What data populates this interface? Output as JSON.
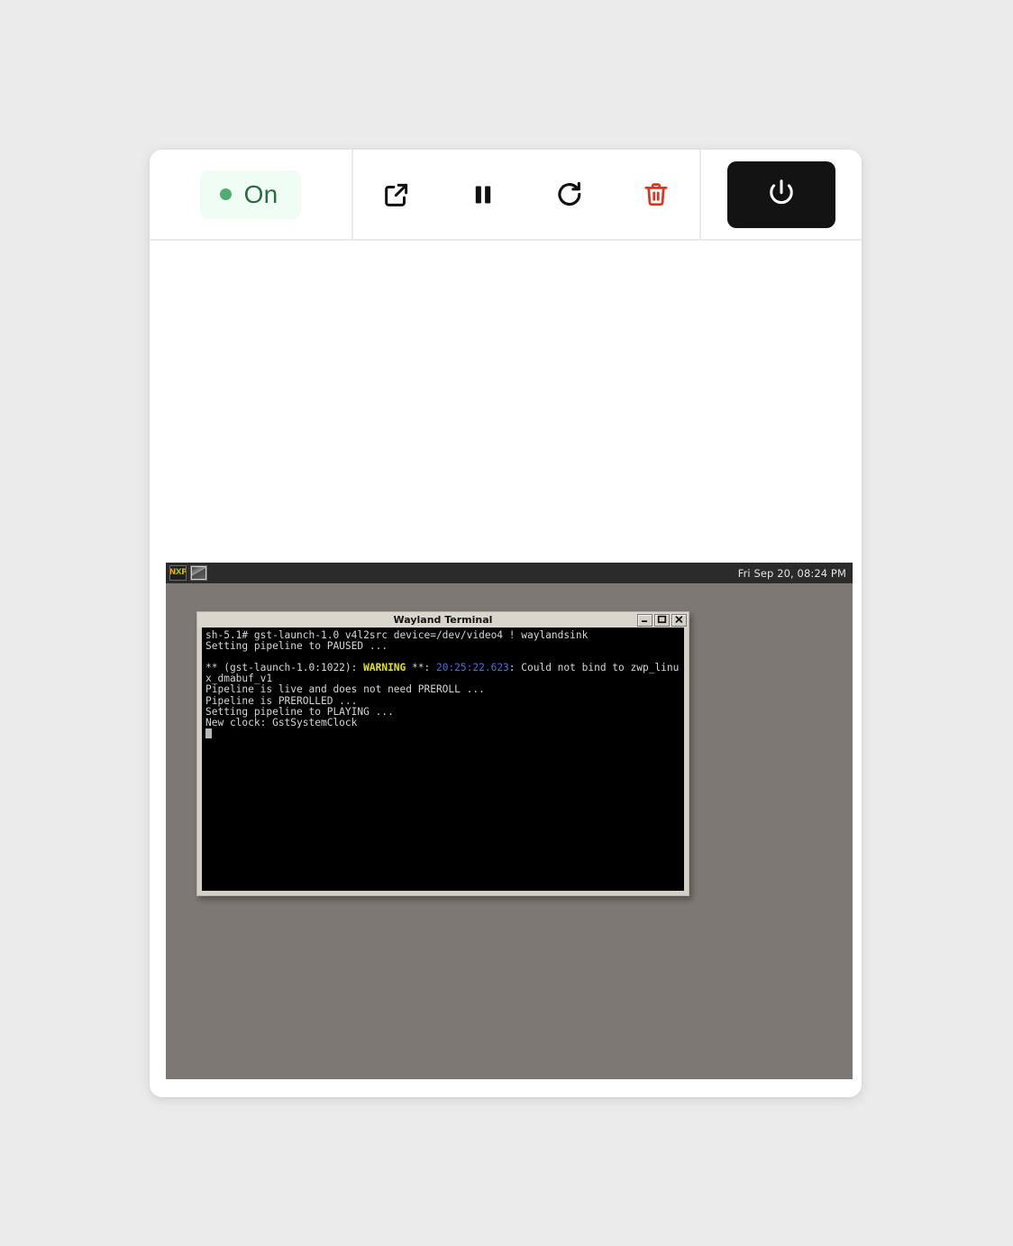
{
  "device_panel": {
    "status": {
      "label": "On",
      "dot_color": "#4fae6f",
      "bg_color": "#f0fdf4",
      "text_color": "#2b6b42"
    },
    "actions": [
      {
        "name": "open-external",
        "icon": "external-link-icon",
        "color": "#111111"
      },
      {
        "name": "pause",
        "icon": "pause-icon",
        "color": "#111111"
      },
      {
        "name": "restart",
        "icon": "refresh-icon",
        "color": "#111111"
      },
      {
        "name": "delete",
        "icon": "trash-icon",
        "color": "#e03423"
      }
    ],
    "power": {
      "icon": "power-icon",
      "bg_color": "#131313",
      "icon_color": "#ffffff"
    }
  },
  "desktop": {
    "taskbar": {
      "launcher_icon": "nxp-logo-icon",
      "logo_text": {
        "n": "N",
        "x": "X",
        "p": "P"
      },
      "window_icon": "window-thumbnail-icon",
      "clock": "Fri Sep 20, 08:24 PM"
    },
    "background_color": "#7d7873"
  },
  "terminal_window": {
    "title": "Wayland Terminal",
    "controls": {
      "minimize": "_",
      "maximize": "□",
      "close": "×"
    },
    "lines": {
      "l1": "sh-5.1# gst-launch-1.0 v4l2src device=/dev/video4 ! waylandsink",
      "l2": "Setting pipeline to PAUSED ...",
      "l4_pre": "** (gst-launch-1.0:1022): ",
      "l4_warn": "WARNING",
      "l4_mid": " **: ",
      "l4_time": "20:25:22.623",
      "l4_post": ": Could not bind to zwp_linux_dmabuf_v1",
      "l5": "Pipeline is live and does not need PREROLL ...",
      "l6": "Pipeline is PREROLLED ...",
      "l7": "Setting pipeline to PLAYING ...",
      "l8": "New clock: GstSystemClock"
    }
  }
}
